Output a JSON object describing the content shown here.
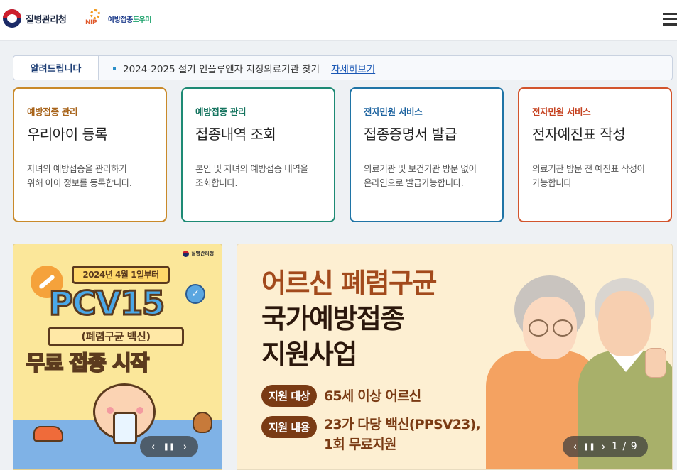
{
  "header": {
    "kdca_logo_text": "질병관리청",
    "nip_logo_mark": "NIP",
    "nip_logo_text_a": "예방접종",
    "nip_logo_text_b": "도우미",
    "menu_icon": "hamburger-menu-icon"
  },
  "notice": {
    "label": "알려드립니다",
    "text": "2024-2025 절기 인플루엔자 지정의료기관 찾기",
    "link": "자세히보기"
  },
  "cards": [
    {
      "category": "예방접종 관리",
      "title": "우리아이 등록",
      "desc1": "자녀의 예방접종을 관리하기",
      "desc2": "위해 아이 정보를 등록합니다."
    },
    {
      "category": "예방접종 관리",
      "title": "접종내역 조회",
      "desc1": "본인 및 자녀의 예방접종 내역을",
      "desc2": "조회합니다."
    },
    {
      "category": "전자민원 서비스",
      "title": "접종증명서 발급",
      "desc1": "의료기관 및 보건기관 방문 없이",
      "desc2": "온라인으로 발급가능합니다."
    },
    {
      "category": "전자민원 서비스",
      "title": "전자예진표 작성",
      "desc1": "의료기관 방문 전 예진표 작성이",
      "desc2": "가능합니다"
    }
  ],
  "banner_left": {
    "org": "질병관리청",
    "date_ribbon": "2024년 4월 1일부터",
    "vaccine": "PCV15",
    "subtitle": "(폐렴구균 백신)",
    "headline_a": "무료 접종",
    "headline_b": "시작",
    "controls": {
      "prev": "‹",
      "pause": "❚❚",
      "next": "›"
    }
  },
  "banner_right": {
    "title_line1": "어르신 폐렴구균",
    "title_line2": "국가예방접종",
    "title_line3": "지원사업",
    "target_label": "지원 대상",
    "target_value": "65세 이상 어르신",
    "content_label": "지원 내용",
    "content_value1": "23가 다당 백신(PPSV23),",
    "content_value2": "1회 무료지원",
    "controls": {
      "prev": "‹",
      "pause": "❚❚",
      "next": "›",
      "counter": "1 / 9"
    }
  },
  "colors": {
    "card1": "#c98a2a",
    "card2": "#1d8a74",
    "card3": "#1f74a6",
    "card4": "#d2542c",
    "banner_brown": "#7a3b14"
  }
}
